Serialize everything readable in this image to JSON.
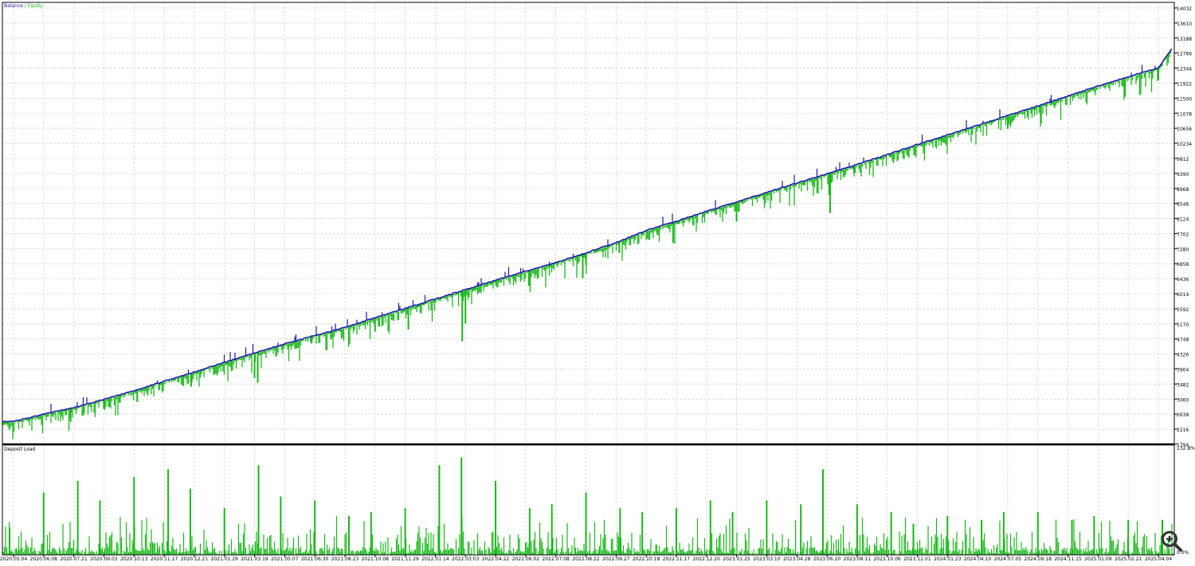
{
  "chart_data": [
    {
      "type": "line",
      "legend": {
        "balance": "Balance",
        "separator": " / ",
        "equity": "Equity"
      },
      "colors": {
        "balance": "#1a1aa6",
        "equity": "#19b819",
        "grid": "#d6d6d6",
        "frame": "#000000"
      },
      "y_ticks": [
        "14032",
        "13610",
        "13188",
        "12766",
        "12344",
        "11922",
        "11500",
        "11078",
        "10656",
        "10234",
        "9812",
        "9390",
        "8968",
        "8546",
        "8124",
        "7702",
        "7280",
        "6858",
        "6436",
        "6014",
        "5592",
        "5170",
        "4748",
        "4326",
        "3904",
        "3482",
        "3060",
        "2638",
        "2216",
        "1794"
      ],
      "ylim": [
        1794,
        14032
      ],
      "x_ticks": [
        "2020.05.04",
        "2020.06.08",
        "2020.07.21",
        "2020.09.03",
        "2020.10.13",
        "2020.11.17",
        "2020.12.21",
        "2021.01.29",
        "2021.03.19",
        "2021.05.07",
        "2021.06.30",
        "2021.08.23",
        "2021.10.08",
        "2021.11.29",
        "2022.01.14",
        "2022.03.03",
        "2022.04.22",
        "2022.06.02",
        "2022.07.08",
        "2022.08.22",
        "2022.09.27",
        "2022.10.18",
        "2022.11.17",
        "2022.12.20",
        "2023.01.25",
        "2023.03.10",
        "2023.04.28",
        "2023.06.20",
        "2023.08.11",
        "2023.10.06",
        "2023.12.01",
        "2024.01.23",
        "2024.04.10",
        "2024.07.05",
        "2024.09.18",
        "2024.11.15",
        "2025.01.09",
        "2025.02.21",
        "2025.04.04"
      ],
      "balance_points": [
        [
          "2020.05.04",
          2430
        ],
        [
          "2020.06.08",
          2640
        ],
        [
          "2020.07.21",
          2820
        ],
        [
          "2020.09.03",
          3050
        ],
        [
          "2020.10.13",
          3290
        ],
        [
          "2020.11.17",
          3560
        ],
        [
          "2020.12.21",
          3820
        ],
        [
          "2021.01.29",
          4090
        ],
        [
          "2021.03.19",
          4350
        ],
        [
          "2021.05.07",
          4610
        ],
        [
          "2021.06.30",
          4840
        ],
        [
          "2021.08.23",
          5070
        ],
        [
          "2021.10.08",
          5340
        ],
        [
          "2021.11.29",
          5600
        ],
        [
          "2022.01.14",
          5870
        ],
        [
          "2022.03.03",
          6130
        ],
        [
          "2022.04.22",
          6400
        ],
        [
          "2022.06.02",
          6640
        ],
        [
          "2022.07.08",
          6890
        ],
        [
          "2022.08.22",
          7160
        ],
        [
          "2022.09.27",
          7450
        ],
        [
          "2022.10.18",
          7790
        ],
        [
          "2022.11.17",
          8050
        ],
        [
          "2022.12.20",
          8330
        ],
        [
          "2023.01.25",
          8590
        ],
        [
          "2023.03.10",
          8860
        ],
        [
          "2023.04.28",
          9120
        ],
        [
          "2023.06.20",
          9380
        ],
        [
          "2023.08.11",
          9640
        ],
        [
          "2023.10.06",
          9920
        ],
        [
          "2023.12.01",
          10200
        ],
        [
          "2024.01.23",
          10470
        ],
        [
          "2024.04.10",
          10740
        ],
        [
          "2024.07.05",
          11010
        ],
        [
          "2024.09.18",
          11290
        ],
        [
          "2024.11.15",
          11560
        ],
        [
          "2025.01.09",
          11840
        ],
        [
          "2025.02.21",
          12100
        ],
        [
          "2025.04.04",
          12350
        ],
        [
          "2025.05.05",
          12920
        ]
      ],
      "equity_drawdowns": [
        [
          "2020.07.21",
          2420
        ],
        [
          "2020.09.03",
          2780
        ],
        [
          "2020.10.13",
          2980
        ],
        [
          "2020.12.21",
          3410
        ],
        [
          "2021.03.19",
          3650
        ],
        [
          "2021.03.19",
          3520
        ],
        [
          "2021.06.30",
          4640
        ],
        [
          "2021.10.08",
          4950
        ],
        [
          "2021.11.29",
          5010
        ],
        [
          "2022.03.03",
          4680
        ],
        [
          "2022.03.03",
          5180
        ],
        [
          "2022.06.02",
          6240
        ],
        [
          "2022.08.22",
          6450
        ],
        [
          "2022.08.22",
          6820
        ],
        [
          "2022.09.27",
          7160
        ],
        [
          "2022.11.17",
          7440
        ],
        [
          "2023.01.25",
          8040
        ],
        [
          "2023.06.20",
          8280
        ],
        [
          "2023.08.11",
          9410
        ],
        [
          "2024.07.05",
          10640
        ],
        [
          "2024.09.18",
          10790
        ],
        [
          "2025.02.21",
          11540
        ],
        [
          "2025.04.04",
          12010
        ]
      ]
    },
    {
      "type": "bar",
      "label": "Deposit Load",
      "top_label": "132.8%",
      "bottom_label": "0.0%",
      "ylim": [
        0,
        132.8
      ],
      "color": "#19b819",
      "spikes": [
        [
          "2020.05.04",
          35
        ],
        [
          "2020.06.08",
          80
        ],
        [
          "2020.07.21",
          95
        ],
        [
          "2020.09.03",
          70
        ],
        [
          "2020.10.13",
          100
        ],
        [
          "2020.11.17",
          110
        ],
        [
          "2020.12.21",
          85
        ],
        [
          "2021.01.29",
          60
        ],
        [
          "2021.03.19",
          115
        ],
        [
          "2021.05.07",
          75
        ],
        [
          "2021.06.30",
          70
        ],
        [
          "2021.08.23",
          50
        ],
        [
          "2021.10.08",
          55
        ],
        [
          "2021.11.29",
          60
        ],
        [
          "2022.01.14",
          115
        ],
        [
          "2022.03.03",
          125
        ],
        [
          "2022.04.22",
          95
        ],
        [
          "2022.06.02",
          60
        ],
        [
          "2022.07.08",
          65
        ],
        [
          "2022.08.22",
          80
        ],
        [
          "2022.09.27",
          60
        ],
        [
          "2022.10.18",
          55
        ],
        [
          "2022.11.17",
          60
        ],
        [
          "2022.12.20",
          70
        ],
        [
          "2023.01.25",
          55
        ],
        [
          "2023.03.10",
          70
        ],
        [
          "2023.04.28",
          65
        ],
        [
          "2023.06.20",
          110
        ],
        [
          "2023.08.11",
          65
        ],
        [
          "2023.10.06",
          55
        ],
        [
          "2023.12.01",
          40
        ],
        [
          "2024.01.23",
          50
        ],
        [
          "2024.04.10",
          45
        ],
        [
          "2024.07.05",
          55
        ],
        [
          "2024.09.18",
          55
        ],
        [
          "2024.11.15",
          45
        ],
        [
          "2025.01.09",
          50
        ],
        [
          "2025.02.21",
          45
        ],
        [
          "2025.04.04",
          45
        ]
      ]
    }
  ]
}
